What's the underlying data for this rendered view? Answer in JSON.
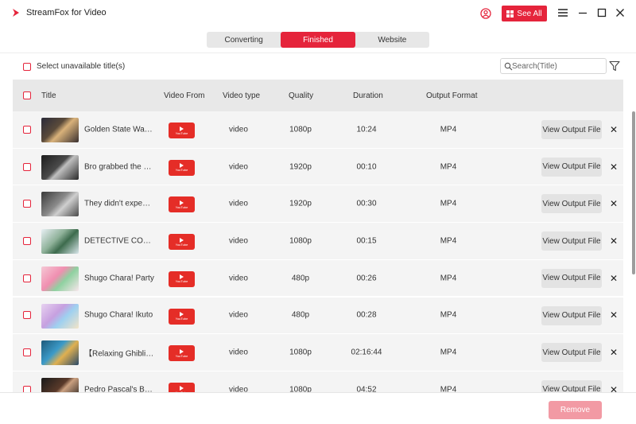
{
  "app": {
    "title": "StreamFox for Video",
    "see_all_label": "See All",
    "accent_color": "#e5243b"
  },
  "tabs": [
    {
      "label": "Converting",
      "active": false
    },
    {
      "label": "Finished",
      "active": true
    },
    {
      "label": "Website",
      "active": false
    }
  ],
  "toolbar": {
    "select_unavailable_label": "Select unavailable title(s)",
    "search_placeholder": "Search(Title)"
  },
  "table": {
    "headers": {
      "title": "Title",
      "video_from": "Video From",
      "video_type": "Video type",
      "quality": "Quality",
      "duration": "Duration",
      "output_format": "Output Format"
    },
    "action_label": "View Output File",
    "source_icon": "youtube-logo",
    "rows": [
      {
        "title": "Golden State Warriors",
        "type": "video",
        "quality": "1080p",
        "duration": "10:24",
        "format": "MP4"
      },
      {
        "title": "Bro grabbed the wrong",
        "type": "video",
        "quality": "1920p",
        "duration": "00:10",
        "format": "MP4"
      },
      {
        "title": "They didn't expect that",
        "type": "video",
        "quality": "1920p",
        "duration": "00:30",
        "format": "MP4"
      },
      {
        "title": "DETECTIVE CONAN",
        "type": "video",
        "quality": "1080p",
        "duration": "00:15",
        "format": "MP4"
      },
      {
        "title": "Shugo Chara! Party",
        "type": "video",
        "quality": "480p",
        "duration": "00:26",
        "format": "MP4"
      },
      {
        "title": "Shugo Chara! Ikuto",
        "type": "video",
        "quality": "480p",
        "duration": "00:28",
        "format": "MP4"
      },
      {
        "title": "【Relaxing Ghibli Music】",
        "type": "video",
        "quality": "1080p",
        "duration": "02:16:44",
        "format": "MP4"
      },
      {
        "title": "Pedro Pascal's Best",
        "type": "video",
        "quality": "1080p",
        "duration": "04:52",
        "format": "MP4"
      }
    ]
  },
  "footer": {
    "remove_label": "Remove"
  }
}
